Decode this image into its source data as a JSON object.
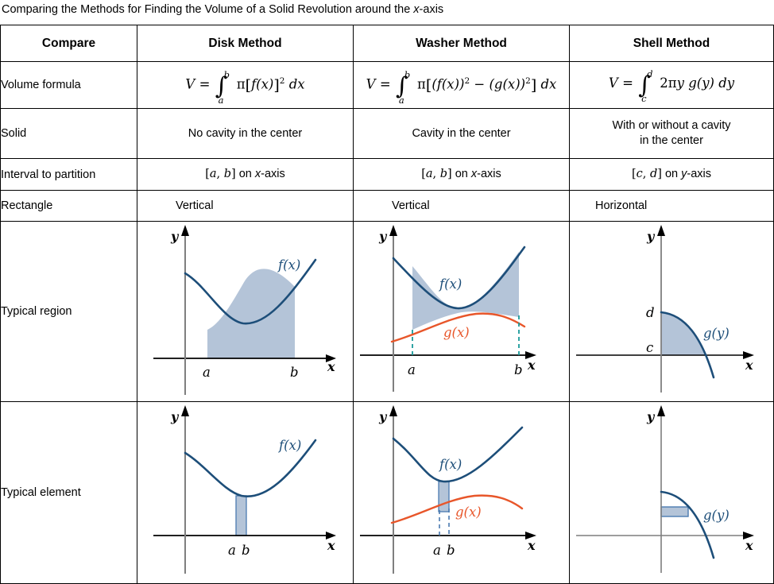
{
  "caption": {
    "text_before": "Comparing the Methods for Finding the Volume of a Solid Revolution around the ",
    "text_italic": "x",
    "text_after": "-axis",
    "full": "Comparing the Methods for Finding the Volume of a Solid Revolution around the x-axis"
  },
  "table": {
    "headers": [
      "Compare",
      "Disk Method",
      "Washer Method",
      "Shell Method"
    ],
    "rows": [
      {
        "label": "Volume formula",
        "cells": [
          {
            "type": "math",
            "text": "V = ∫ₐᵇ π[f(x)]² dx",
            "lhs": "V",
            "eq": "=",
            "lower": "a",
            "upper": "b",
            "body": "π[f(x)]² dx"
          },
          {
            "type": "math",
            "text": "V = ∫ₐᵇ π[(f(x))² − (g(x))²] dx",
            "lhs": "V",
            "eq": "=",
            "lower": "a",
            "upper": "b",
            "body": "π[(f(x))² − (g(x))²] dx"
          },
          {
            "type": "math",
            "text": "V = ∫_c^d 2πy g(y) dy",
            "lhs": "V",
            "eq": "=",
            "lower": "c",
            "upper": "d",
            "body": "2πy g(y) dy"
          }
        ]
      },
      {
        "label": "Solid",
        "cells": [
          {
            "type": "text",
            "text": "No cavity in the center"
          },
          {
            "type": "text",
            "text": "Cavity in the center"
          },
          {
            "type": "text",
            "text": "With or without a cavity\nin the center",
            "line1": "With or without a cavity",
            "line2": "in the center"
          }
        ]
      },
      {
        "label": "Interval to partition",
        "cells": [
          {
            "type": "interval",
            "text": "[a, b] on x-axis",
            "bracket": "[a, b]",
            "suffix": " on ",
            "axis": "x",
            "axis_suffix": "-axis"
          },
          {
            "type": "interval",
            "text": "[a, b] on x-axis",
            "bracket": "[a, b]",
            "suffix": " on ",
            "axis": "x",
            "axis_suffix": "-axis"
          },
          {
            "type": "interval",
            "text": "[c, d] on y-axis",
            "bracket": "[c, d]",
            "suffix": " on ",
            "axis": "y",
            "axis_suffix": "-axis"
          }
        ]
      },
      {
        "label": "Rectangle",
        "cells": [
          {
            "type": "text",
            "text": "Vertical"
          },
          {
            "type": "text",
            "text": "Vertical"
          },
          {
            "type": "text",
            "text": "Horizontal"
          }
        ]
      },
      {
        "label": "Typical region",
        "cells": [
          {
            "type": "graph",
            "id": "disk-region"
          },
          {
            "type": "graph",
            "id": "washer-region"
          },
          {
            "type": "graph",
            "id": "shell-region"
          }
        ]
      },
      {
        "label": "Typical element",
        "cells": [
          {
            "type": "graph",
            "id": "disk-element"
          },
          {
            "type": "graph",
            "id": "washer-element"
          },
          {
            "type": "graph",
            "id": "shell-element"
          }
        ]
      }
    ]
  },
  "graphs": {
    "disk_region": {
      "axis_labels": {
        "y": "y",
        "x": "x"
      },
      "curve_labels": [
        {
          "text": "f(x)",
          "color": "#1d4e79"
        }
      ],
      "tick_labels": [
        "a",
        "b"
      ],
      "shaded": true
    },
    "washer_region": {
      "axis_labels": {
        "y": "y",
        "x": "x"
      },
      "curve_labels": [
        {
          "text": "f(x)",
          "color": "#1d4e79"
        },
        {
          "text": "g(x)",
          "color": "#e8562a"
        }
      ],
      "tick_labels": [
        "a",
        "b"
      ],
      "shaded": true,
      "dashed_color": "#1a9a9a"
    },
    "shell_region": {
      "axis_labels": {
        "y": "y",
        "x": "x"
      },
      "curve_labels": [
        {
          "text": "g(y)",
          "color": "#1d4e79"
        }
      ],
      "tick_labels": [
        "d",
        "c"
      ],
      "shaded": true
    },
    "disk_element": {
      "axis_labels": {
        "y": "y",
        "x": "x"
      },
      "curve_labels": [
        {
          "text": "f(x)",
          "color": "#1d4e79"
        }
      ],
      "tick_labels": [
        "a",
        "b"
      ],
      "strip": "vertical"
    },
    "washer_element": {
      "axis_labels": {
        "y": "y",
        "x": "x"
      },
      "curve_labels": [
        {
          "text": "f(x)",
          "color": "#1d4e79"
        },
        {
          "text": "g(x)",
          "color": "#e8562a"
        }
      ],
      "tick_labels": [
        "a",
        "b"
      ],
      "strip": "vertical"
    },
    "shell_element": {
      "axis_labels": {
        "y": "y",
        "x": "x"
      },
      "curve_labels": [
        {
          "text": "g(y)",
          "color": "#1d4e79"
        }
      ],
      "tick_labels": [],
      "strip": "horizontal"
    }
  },
  "colors": {
    "curve_blue": "#1d4e79",
    "curve_orange": "#e8562a",
    "fill_blue": "#b4c4d8",
    "dashed_teal": "#1a9a9a",
    "axis_gray": "#7f7f7f",
    "axis_black": "#000000",
    "border": "#000000"
  }
}
